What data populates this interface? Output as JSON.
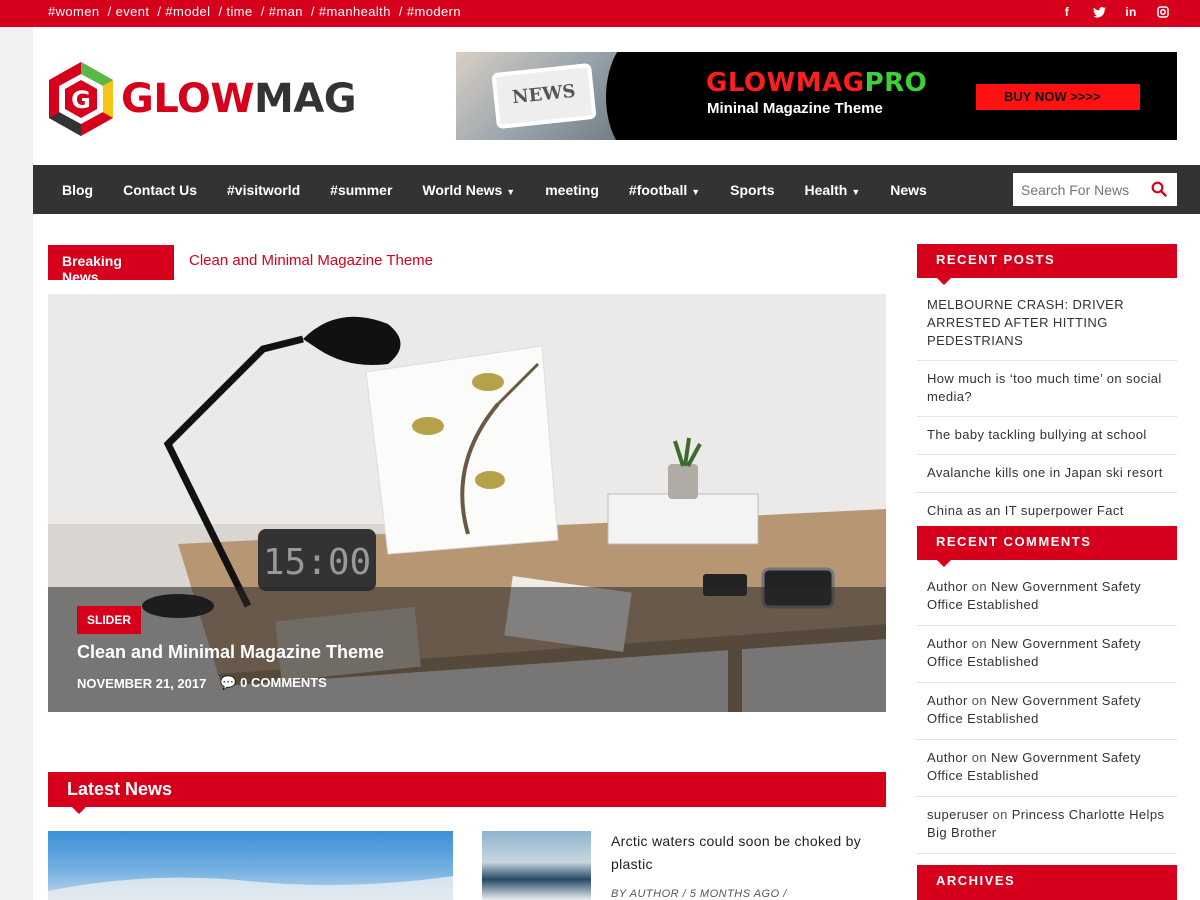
{
  "topbar": {
    "tags": [
      "#women",
      "/ event",
      "/ #model",
      "/ time",
      "/ #man",
      "/ #manhealth",
      "/ #modern"
    ],
    "social": [
      "facebook-icon",
      "twitter-icon",
      "linkedin-icon",
      "instagram-icon"
    ]
  },
  "logo": {
    "part1": "GLOW",
    "part2": "MAG"
  },
  "banner": {
    "phone_text": "NEWS",
    "title_red": "GLOWMAG",
    "title_green": "PRO",
    "subtitle": "Mininal Magazine Theme",
    "cta": "BUY NOW >>>>"
  },
  "nav": {
    "items": [
      {
        "label": "Blog",
        "dropdown": false
      },
      {
        "label": "Contact Us",
        "dropdown": false
      },
      {
        "label": "#visitworld",
        "dropdown": false
      },
      {
        "label": "#summer",
        "dropdown": false
      },
      {
        "label": "World News",
        "dropdown": true
      },
      {
        "label": "meeting",
        "dropdown": false
      },
      {
        "label": "#football",
        "dropdown": true
      },
      {
        "label": "Sports",
        "dropdown": false
      },
      {
        "label": "Health",
        "dropdown": true
      },
      {
        "label": "News",
        "dropdown": false
      }
    ],
    "search_placeholder": "Search For News"
  },
  "breaking": {
    "label": "Breaking News",
    "text": "Clean and Minimal Magazine Theme"
  },
  "slider": {
    "category": "SLIDER",
    "title": "Clean and Minimal Magazine Theme",
    "date": "NOVEMBER 21, 2017",
    "comments": "0 COMMENTS",
    "clock": "15:00"
  },
  "latest": {
    "heading": "Latest News",
    "item": {
      "title": "Arctic waters could soon be choked by plastic",
      "meta": "BY AUTHOR   /   5 MONTHS AGO   /"
    }
  },
  "sidebar": {
    "recent_posts_title": "RECENT POSTS",
    "recent_posts": [
      "MELBOURNE CRASH: DRIVER ARRESTED AFTER HITTING PEDESTRIANS",
      "How much is ‘too much time’ on social media?",
      "The baby tackling bullying at school",
      "Avalanche kills one in Japan ski resort",
      "China as an IT superpower Fact"
    ],
    "recent_comments_title": "RECENT COMMENTS",
    "recent_comments": [
      {
        "author": "Author",
        "on": "on",
        "post": "New Government Safety Office Established"
      },
      {
        "author": "Author",
        "on": "on",
        "post": "New Government Safety Office Established"
      },
      {
        "author": "Author",
        "on": "on",
        "post": "New Government Safety Office Established"
      },
      {
        "author": "Author",
        "on": "on",
        "post": "New Government Safety Office Established"
      },
      {
        "author": "superuser",
        "on": "on",
        "post": "Princess Charlotte Helps Big Brother"
      }
    ],
    "archives_title": "ARCHIVES"
  },
  "colors": {
    "accent": "#d6001c",
    "nav_bg": "#333333"
  }
}
